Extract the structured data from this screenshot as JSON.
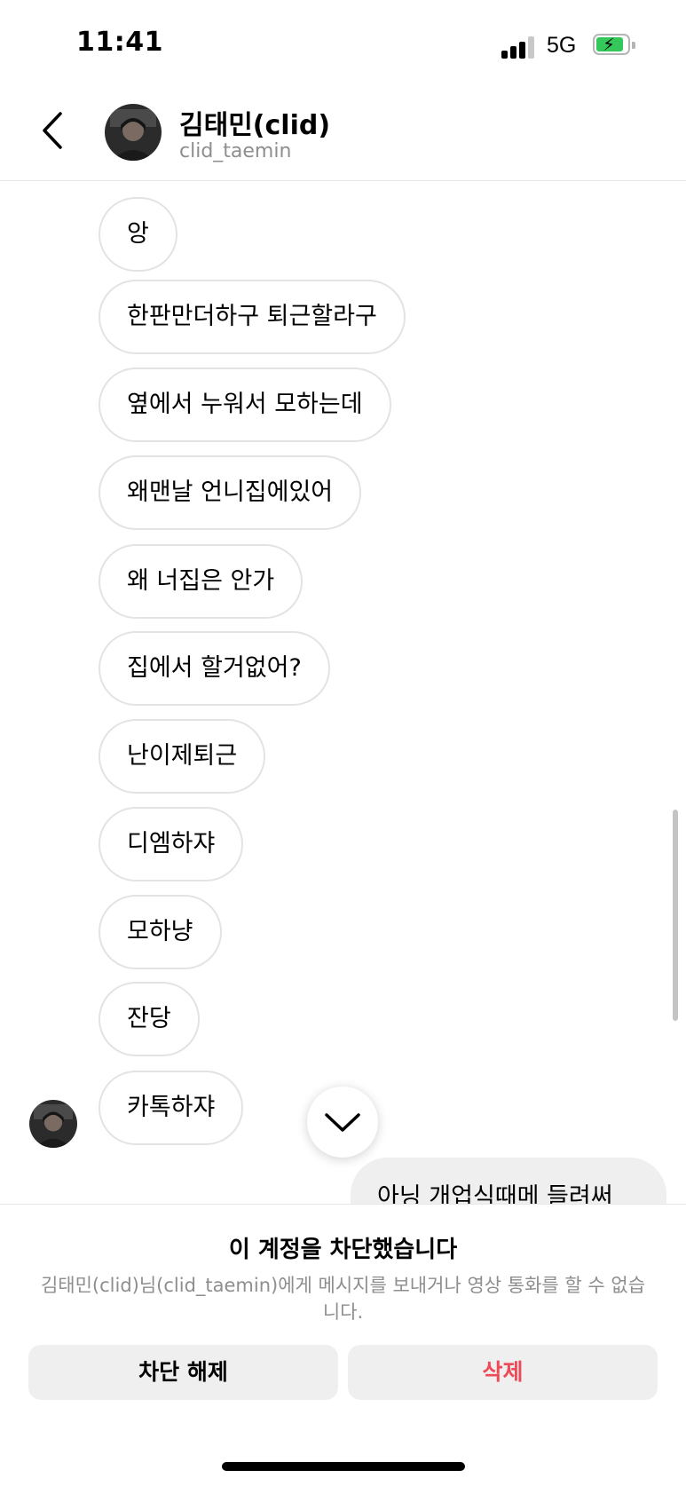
{
  "status_bar": {
    "time": "11:41",
    "network": "5G",
    "battery_charging": true,
    "battery_color": "#34c759"
  },
  "header": {
    "back_icon": "chevron-left-icon",
    "name": "김태민(clid)",
    "username": "clid_taemin"
  },
  "messages": [
    {
      "text": "앙"
    },
    {
      "text": "한판만더하구 퇴근할라구"
    },
    {
      "text": "옆에서 누워서 모하는데"
    },
    {
      "text": "왜맨날 언니집에있어"
    },
    {
      "text": "왜 너집은 안가"
    },
    {
      "text": "집에서 할거없어?"
    },
    {
      "text": "난이제퇴근"
    },
    {
      "text": "디엠하쟈"
    },
    {
      "text": "모하냥"
    },
    {
      "text": "잔당"
    },
    {
      "text": "카톡하쟈"
    }
  ],
  "my_message_partial": "아닝 개업식때메 들려써",
  "scroll_down_icon": "chevron-down-icon",
  "blocked_panel": {
    "title": "이 계정을 차단했습니다",
    "description": "김태민(clid)님(clid_taemin)에게 메시지를 보내거나 영상 통화를 할 수 없습니다.",
    "unblock_label": "차단 해제",
    "delete_label": "삭제",
    "delete_color": "#ed4956"
  }
}
